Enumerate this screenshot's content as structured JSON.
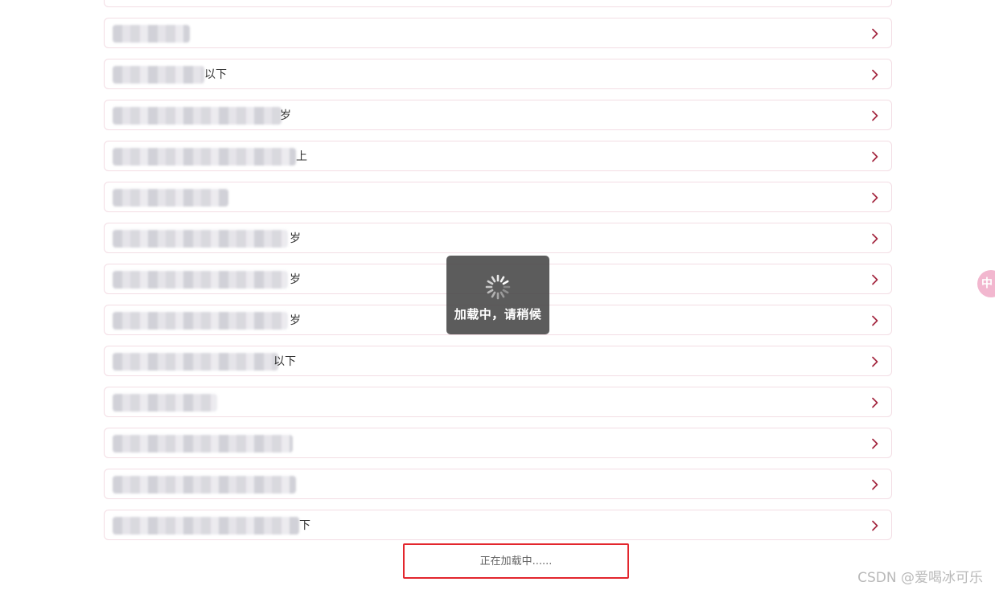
{
  "list": {
    "rows": [
      {
        "suffix": ""
      },
      {
        "suffix": ""
      },
      {
        "suffix": "以下"
      },
      {
        "suffix": "岁"
      },
      {
        "suffix": "上"
      },
      {
        "suffix": ""
      },
      {
        "suffix": "岁"
      },
      {
        "suffix": "岁"
      },
      {
        "suffix": "岁"
      },
      {
        "suffix": "以下"
      },
      {
        "suffix": ""
      },
      {
        "suffix": ""
      },
      {
        "suffix": ""
      },
      {
        "suffix": "下"
      }
    ],
    "chevron_icon": "chevron-right-icon",
    "chevron_color": "#a3263f"
  },
  "toast": {
    "spinner_icon": "spinner-icon",
    "text": "加载中，请稍候"
  },
  "side_bubble": {
    "text": "中"
  },
  "loading_more": {
    "text": "正在加载中......",
    "highlight_color": "#e3262d"
  },
  "watermark": {
    "text": "CSDN @爱喝冰可乐"
  }
}
